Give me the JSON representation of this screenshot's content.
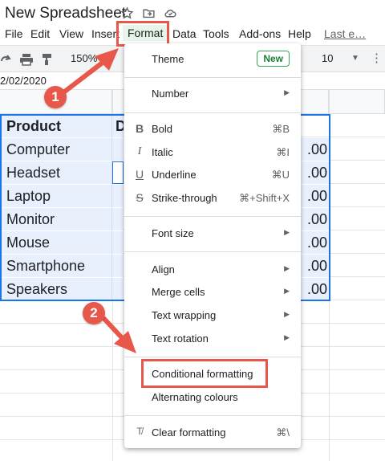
{
  "window": {
    "title": "New Spreadsheet"
  },
  "menubar": {
    "items": [
      "File",
      "Edit",
      "View",
      "Insert",
      "Format",
      "Data",
      "Tools",
      "Add-ons",
      "Help"
    ],
    "last_edit": "Last e…",
    "active": "Format"
  },
  "toolbar": {
    "zoom": "150%",
    "font_size": "10",
    "more": "⋮"
  },
  "cell_ref": "2/02/2020",
  "sheet": {
    "header_a": "Product",
    "header_b": "D",
    "products": [
      "Computer",
      "Headset",
      "Laptop",
      "Monitor",
      "Mouse",
      "Smartphone",
      "Speakers"
    ],
    "values": [
      ".00",
      ".00",
      ".00",
      ".00",
      ".00",
      ".00",
      ".00"
    ]
  },
  "format_menu": {
    "theme": {
      "label": "Theme",
      "badge": "New"
    },
    "number": "Number",
    "bold": {
      "label": "Bold",
      "shortcut": "⌘B"
    },
    "italic": {
      "label": "Italic",
      "shortcut": "⌘I"
    },
    "underline": {
      "label": "Underline",
      "shortcut": "⌘U"
    },
    "strikethrough": {
      "label": "Strike-through",
      "shortcut": "⌘+Shift+X"
    },
    "font_size": "Font size",
    "align": "Align",
    "merge_cells": "Merge cells",
    "text_wrapping": "Text wrapping",
    "text_rotation": "Text rotation",
    "conditional_formatting": "Conditional formatting",
    "alternating_colours": "Alternating colours",
    "clear_formatting": {
      "label": "Clear formatting",
      "shortcut": "⌘\\"
    }
  },
  "callouts": {
    "step1": "1",
    "step2": "2"
  },
  "colors": {
    "accent": "#e8584a",
    "selection": "#e8f0fe",
    "menu_active": "#e6f4ea",
    "badge": "#188038"
  }
}
